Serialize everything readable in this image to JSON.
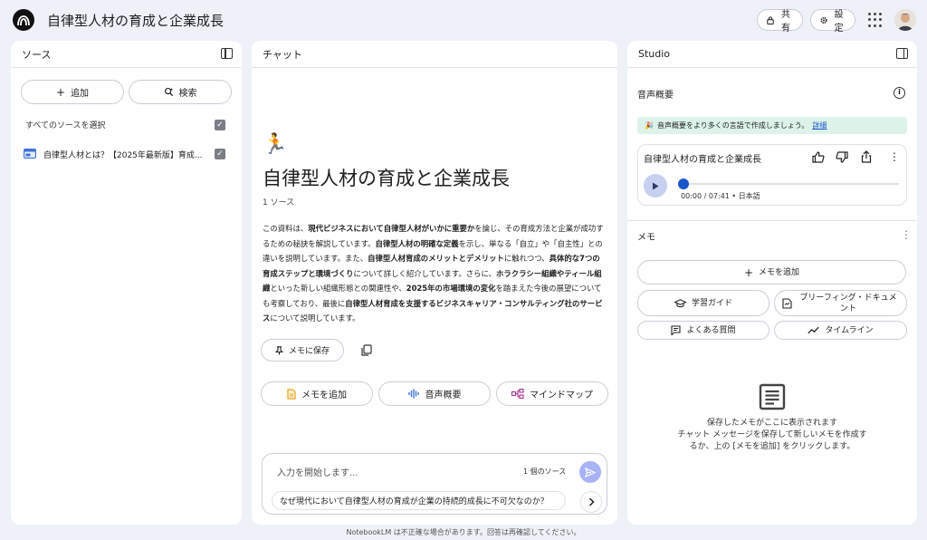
{
  "header": {
    "title": "自律型人材の育成と企業成長",
    "share_label": "共有",
    "settings_label": "設定"
  },
  "sources": {
    "title": "ソース",
    "add_label": "追加",
    "search_label": "検索",
    "select_all_label": "すべてのソースを選択",
    "items": [
      {
        "label": "自律型人材とは？【2025年最新版】育成..."
      }
    ]
  },
  "chat": {
    "title": "チャット",
    "emoji": "🏃",
    "heading": "自律型人材の育成と企業成長",
    "source_count": "1 ソース",
    "summary": [
      {
        "text": "この資料は、",
        "bold": false
      },
      {
        "text": "現代ビジネスにおいて自律型人材がいかに重要か",
        "bold": true
      },
      {
        "text": "を論じ、その育成方法と企業が成功するための秘訣を解説しています。",
        "bold": false
      },
      {
        "text": "自律型人材の明確な定義",
        "bold": true
      },
      {
        "text": "を示し、単なる「自立」や「自主性」との違いを説明しています。また、",
        "bold": false
      },
      {
        "text": "自律型人材育成のメリットとデメリット",
        "bold": true
      },
      {
        "text": "に触れつつ、",
        "bold": false
      },
      {
        "text": "具体的な7つの育成ステップと環境づくり",
        "bold": true
      },
      {
        "text": "について詳しく紹介しています。さらに、",
        "bold": false
      },
      {
        "text": "ホラクラシー組織やティール組織",
        "bold": true
      },
      {
        "text": "といった新しい組織形態との関連性や、",
        "bold": false
      },
      {
        "text": "2025年の市場環境の変化",
        "bold": true
      },
      {
        "text": "を踏まえた今後の展望についても考察しており、最後に",
        "bold": false
      },
      {
        "text": "自律型人材育成を支援するビジネスキャリア・コンサルティング社のサービス",
        "bold": true
      },
      {
        "text": "について説明しています。",
        "bold": false
      }
    ],
    "save_memo_label": "メモに保存",
    "add_memo_label": "メモを追加",
    "audio_overview_label": "音声概要",
    "mindmap_label": "マインドマップ",
    "input_placeholder": "入力を開始します...",
    "input_source_count": "1 個のソース",
    "suggestion": "なぜ現代において自律型人材の育成が企業の持続的成長に不可欠なのか？"
  },
  "studio": {
    "title": "Studio",
    "audio_title": "音声概要",
    "banner_text": "音声概要をより多くの言語で作成しましょう。",
    "banner_link": "詳細",
    "card_title": "自律型人材の育成と企業成長",
    "time_text": "00:00 / 07:41 • 日本語",
    "memo_title": "メモ",
    "add_memo_label": "メモを追加",
    "study_guide_label": "学習ガイド",
    "briefing_label": "ブリーフィング・ドキュメント",
    "faq_label": "よくある質問",
    "timeline_label": "タイムライン",
    "empty_title": "保存したメモがここに表示されます",
    "empty_desc": "チャット メッセージを保存して新しいメモを作成するか、上の [メモを追加] をクリックします。"
  },
  "footer": "NotebookLM は不正確な場合があります。回答は再確認してください。"
}
